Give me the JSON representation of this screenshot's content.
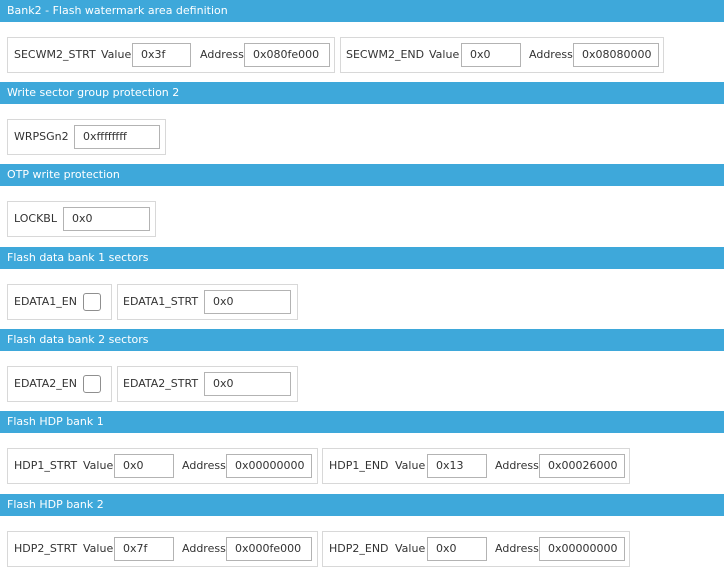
{
  "bank2_watermark": {
    "title": "Bank2 - Flash watermark area definition",
    "secwm2_strt": {
      "label": "SECWM2_STRT",
      "value_label": "Value",
      "value": "0x3f",
      "address_label": "Address",
      "address": "0x080fe000"
    },
    "secwm2_end": {
      "label": "SECWM2_END",
      "value_label": "Value",
      "value": "0x0",
      "address_label": "Address",
      "address": "0x08080000"
    }
  },
  "wrp2": {
    "title": "Write sector group protection 2",
    "wrpsgn2": {
      "label": "WRPSGn2",
      "value": "0xffffffff"
    }
  },
  "otp": {
    "title": "OTP write protection",
    "lockbl": {
      "label": "LOCKBL",
      "value": "0x0"
    }
  },
  "edata1": {
    "title": "Flash data bank 1 sectors",
    "en": {
      "label": "EDATA1_EN",
      "checked": false
    },
    "strt": {
      "label": "EDATA1_STRT",
      "value": "0x0"
    }
  },
  "edata2": {
    "title": "Flash data bank 2 sectors",
    "en": {
      "label": "EDATA2_EN",
      "checked": false
    },
    "strt": {
      "label": "EDATA2_STRT",
      "value": "0x0"
    }
  },
  "hdp1": {
    "title": "Flash HDP bank 1",
    "strt": {
      "label": "HDP1_STRT",
      "value_label": "Value",
      "value": "0x0",
      "address_label": "Address",
      "address": "0x00000000"
    },
    "end": {
      "label": "HDP1_END",
      "value_label": "Value",
      "value": "0x13",
      "address_label": "Address",
      "address": "0x00026000"
    }
  },
  "hdp2": {
    "title": "Flash HDP bank 2",
    "strt": {
      "label": "HDP2_STRT",
      "value_label": "Value",
      "value": "0x7f",
      "address_label": "Address",
      "address": "0x000fe000"
    },
    "end": {
      "label": "HDP2_END",
      "value_label": "Value",
      "value": "0x0",
      "address_label": "Address",
      "address": "0x00000000"
    }
  },
  "colors": {
    "header_bg": "#3ea8da",
    "header_text": "#ffffff",
    "group_border": "#d8d8d8",
    "field_border": "#b3b3b3"
  }
}
